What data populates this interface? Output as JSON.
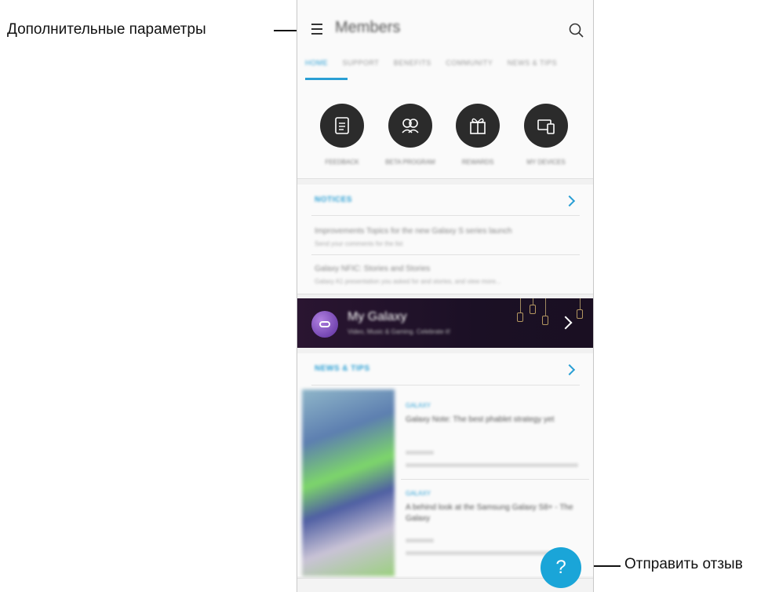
{
  "callouts": {
    "left": "Дополнительные параметры",
    "right": "Отправить отзыв"
  },
  "header": {
    "title": "Members",
    "menu_icon": "menu-icon",
    "search_icon": "search-icon"
  },
  "tabs": [
    {
      "label": "HOME",
      "active": true
    },
    {
      "label": "SUPPORT",
      "active": false
    },
    {
      "label": "BENEFITS",
      "active": false
    },
    {
      "label": "COMMUNITY",
      "active": false
    },
    {
      "label": "NEWS & TIPS",
      "active": false
    }
  ],
  "quick_actions": [
    {
      "label": "FEEDBACK",
      "icon": "document-icon"
    },
    {
      "label": "BETA PROGRAM",
      "icon": "people-icon"
    },
    {
      "label": "REWARDS",
      "icon": "gift-icon"
    },
    {
      "label": "MY DEVICES",
      "icon": "devices-icon"
    }
  ],
  "notices": {
    "heading": "NOTICES",
    "items": [
      {
        "title": "Improvements Topics for the new Galaxy S series launch",
        "subtitle": "Send your comments for the list"
      },
      {
        "title": "Galaxy NFIC: Stories and Stories",
        "subtitle": "Galaxy A1 presentation you asked for and stories, and view more..."
      }
    ]
  },
  "banner": {
    "title": "My Galaxy",
    "subtitle": "Video, Music & Gaming. Celebrate it!"
  },
  "news": {
    "heading": "NEWS & TIPS",
    "items": [
      {
        "tag": "GALAXY",
        "title": "Galaxy Note: The best phablet strategy yet"
      },
      {
        "tag": "GALAXY",
        "title": "A behind look at the Samsung Galaxy S8+ - The Galaxy"
      }
    ]
  },
  "feedback_button": {
    "label": "?"
  },
  "colors": {
    "accent": "#2a9fd4",
    "fab": "#1aa5d8",
    "banner_bg": "#1b1025"
  }
}
